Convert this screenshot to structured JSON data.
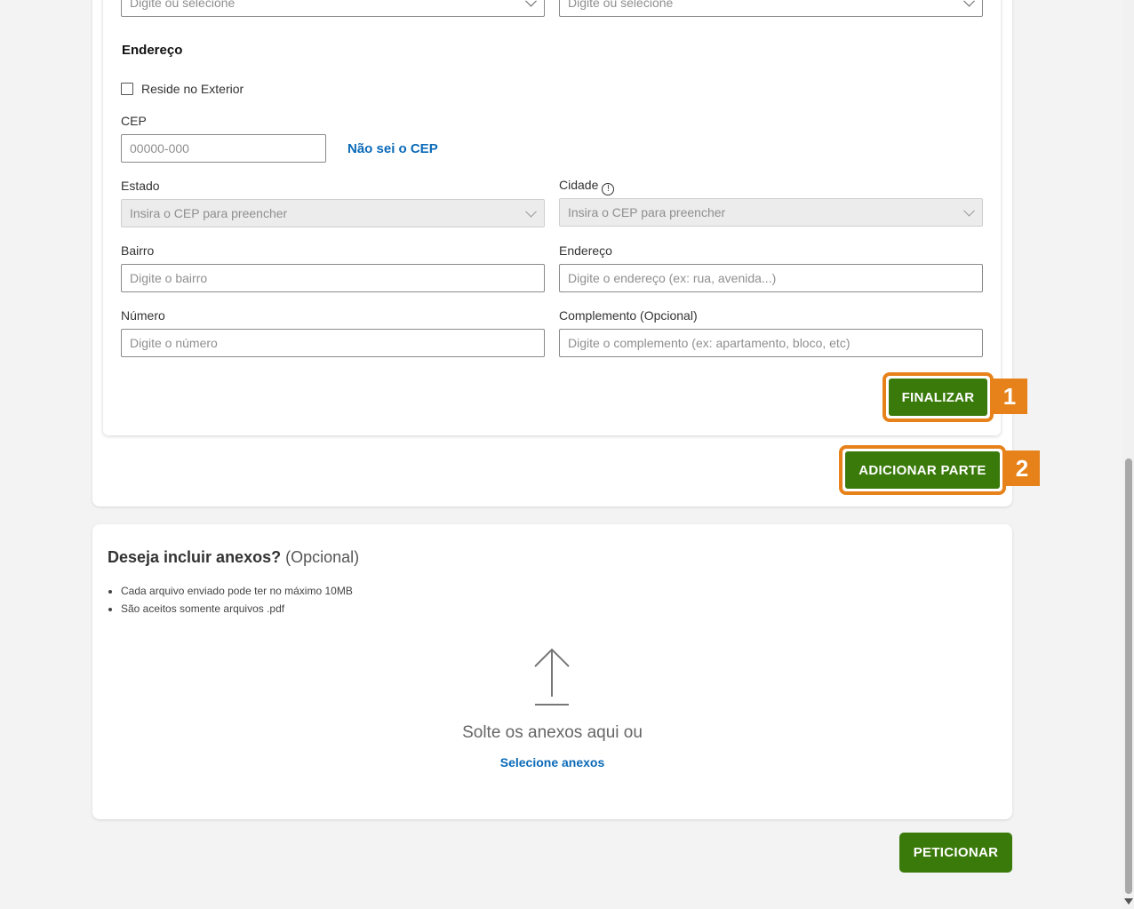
{
  "top_fields": {
    "left_placeholder": "Digite ou selecione",
    "right_placeholder": "Digite ou selecione"
  },
  "address": {
    "title": "Endereço",
    "abroad_label": "Reside no Exterior",
    "cep_label": "CEP",
    "cep_placeholder": "00000-000",
    "cep_unknown_link": "Não sei o CEP",
    "estado_label": "Estado",
    "estado_placeholder": "Insira o CEP para preencher",
    "cidade_label": "Cidade",
    "cidade_info_glyph": "!",
    "cidade_placeholder": "Insira o CEP para preencher",
    "bairro_label": "Bairro",
    "bairro_placeholder": "Digite o bairro",
    "endereco_label": "Endereço",
    "endereco_placeholder": "Digite o endereço (ex: rua, avenida...)",
    "numero_label": "Número",
    "numero_placeholder": "Digite o número",
    "complemento_label": "Complemento (Opcional)",
    "complemento_placeholder": "Digite o complemento (ex: apartamento, bloco, etc)"
  },
  "buttons": {
    "finalizar": "FINALIZAR",
    "finalizar_badge": "1",
    "adicionar_parte": "ADICIONAR PARTE",
    "adicionar_badge": "2",
    "peticionar": "PETICIONAR"
  },
  "attachments": {
    "title": "Deseja incluir anexos?",
    "optional": "(Opcional)",
    "rules": [
      "Cada arquivo enviado pode ter no máximo 10MB",
      "São aceitos somente arquivos .pdf"
    ],
    "drop_text": "Solte os anexos aqui ou",
    "select_link": "Selecione anexos"
  },
  "colors": {
    "primary_green": "#3a7a0b",
    "highlight_orange": "#e68219",
    "link_blue": "#0a6ab8"
  }
}
